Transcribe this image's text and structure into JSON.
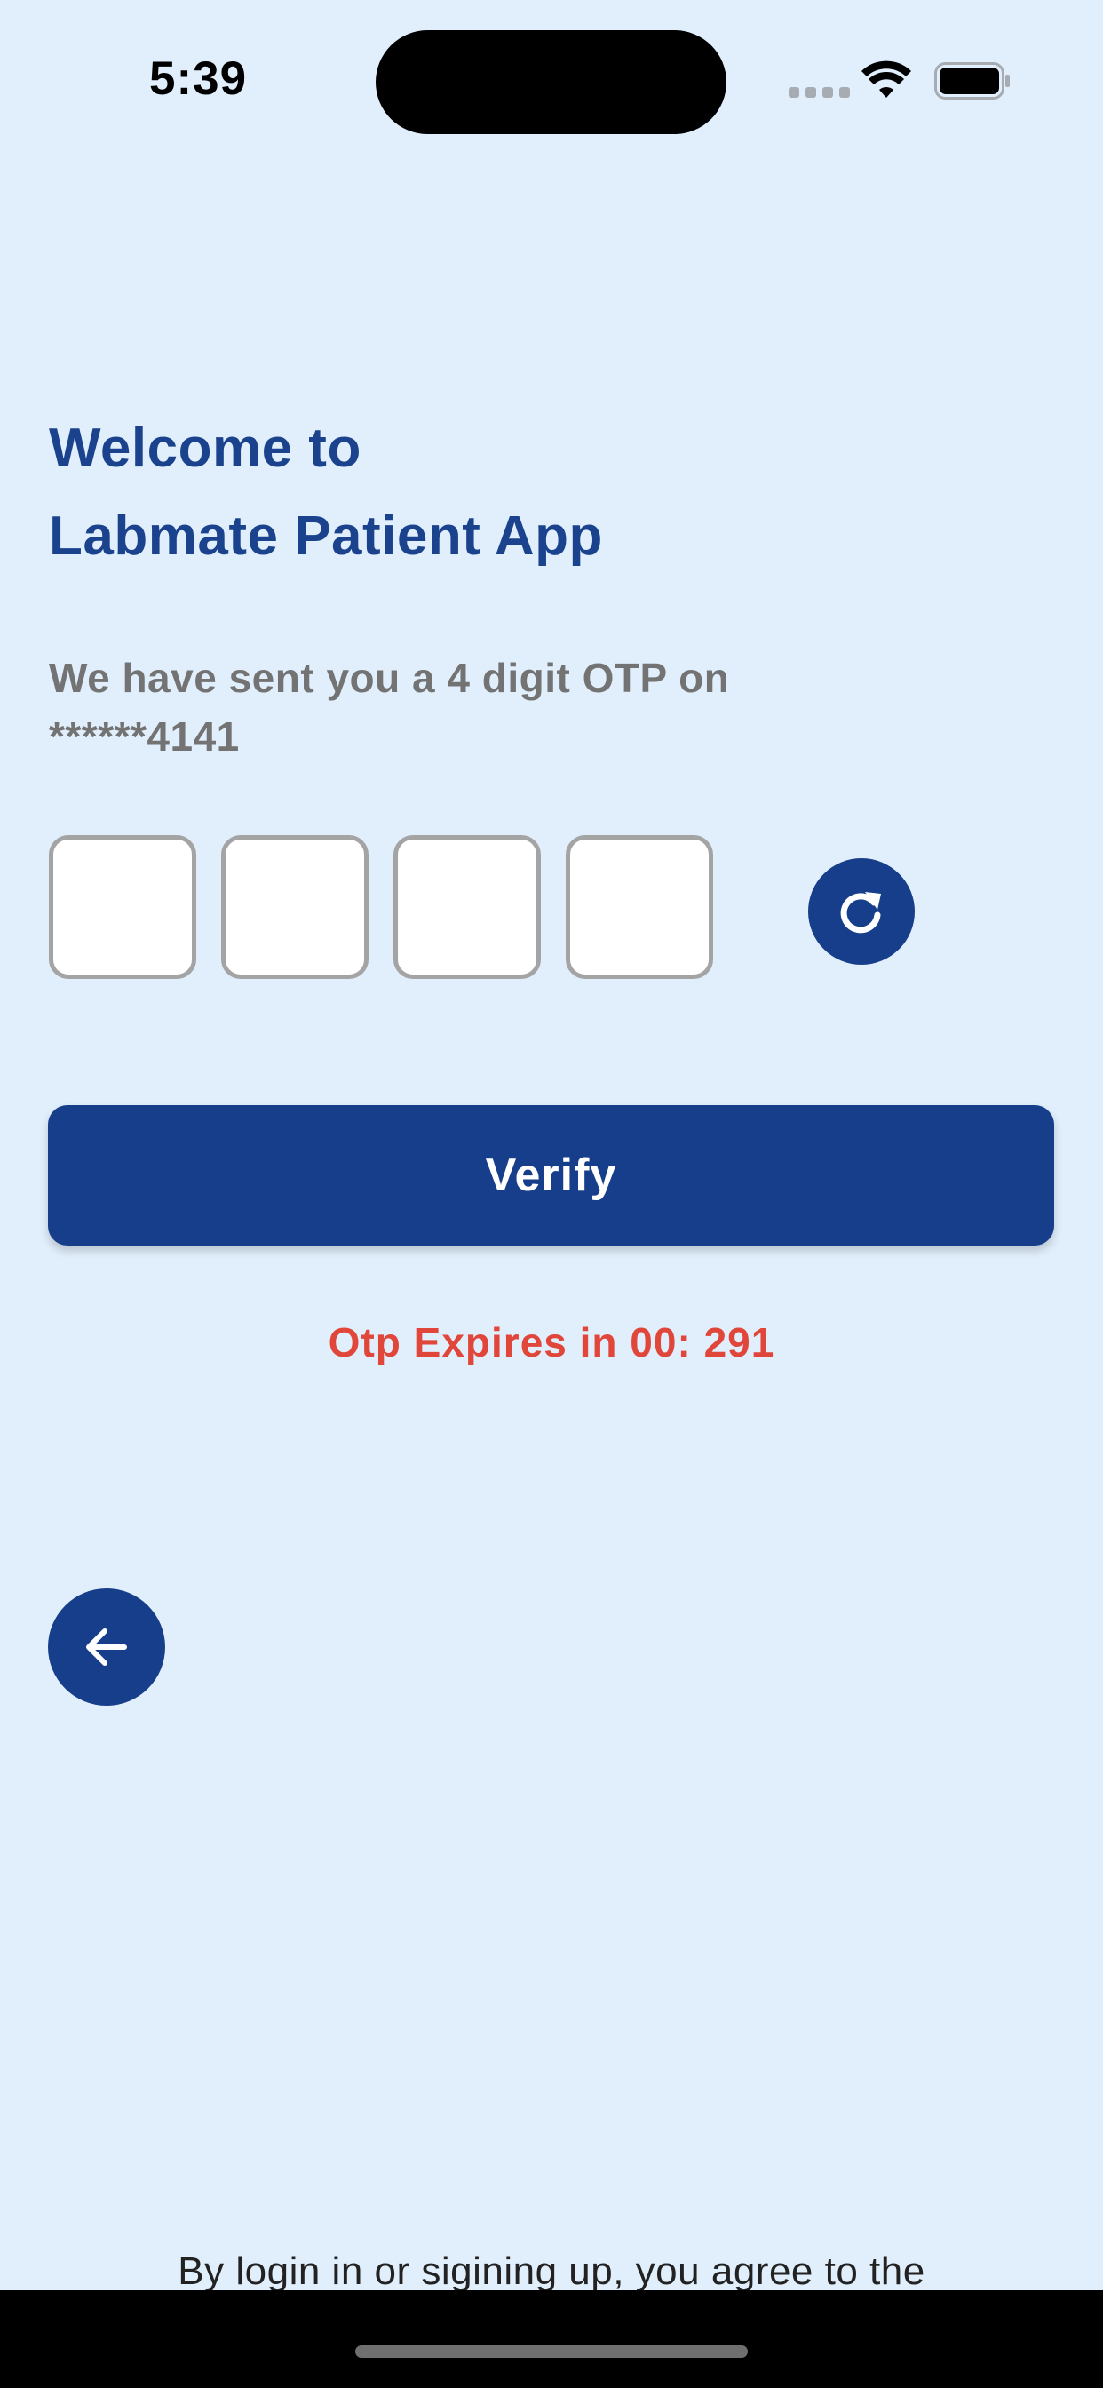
{
  "status_bar": {
    "time": "5:39"
  },
  "header": {
    "title_line1": "Welcome to",
    "title_line2": "Labmate Patient App"
  },
  "otp": {
    "message_line1": "We have sent you a 4 digit OTP on",
    "message_line2": "******4141",
    "digits": [
      "",
      "",
      "",
      ""
    ],
    "refresh_icon": "refresh-icon"
  },
  "actions": {
    "verify_label": "Verify",
    "expiry_text": "Otp Expires in 00: 291",
    "back_icon": "arrow-left-icon"
  },
  "footer": {
    "terms_text": "By login in or sigining up, you agree to the"
  },
  "colors": {
    "background": "#e1effc",
    "primary": "#173e8a",
    "title": "#1b438d",
    "muted_text": "#737373",
    "error": "#e0463a"
  }
}
